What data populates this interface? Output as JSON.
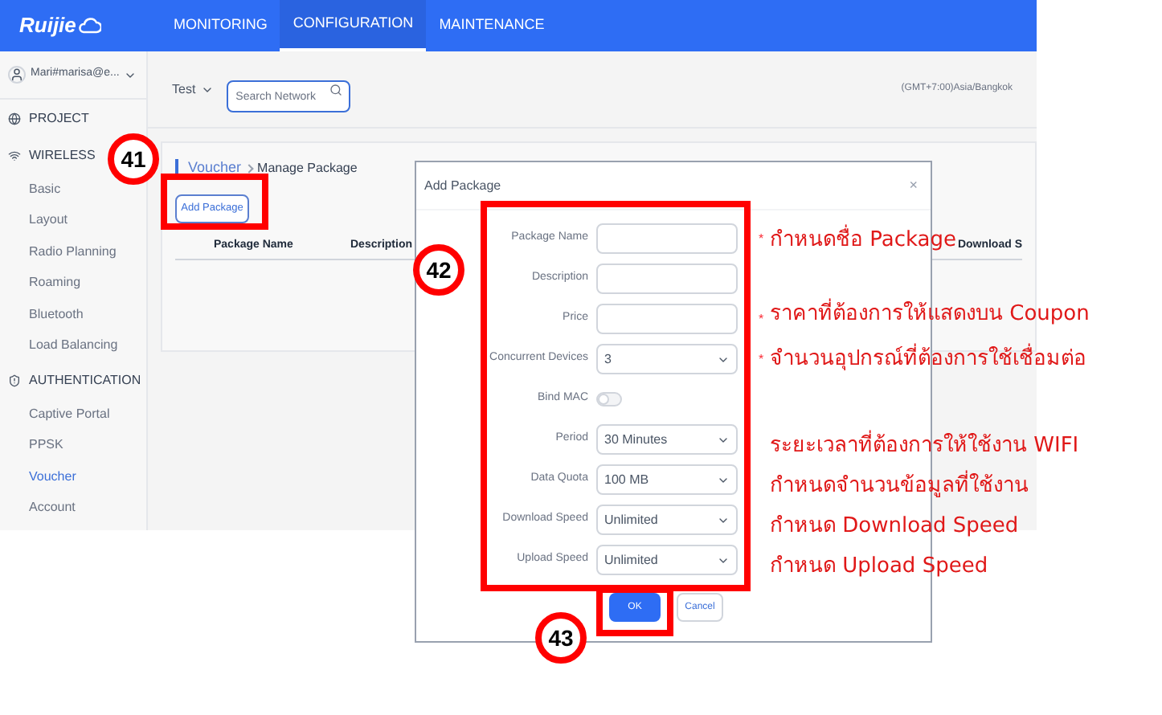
{
  "header": {
    "logo": "Ruijie",
    "nav": [
      {
        "label": "MONITORING",
        "selected": false
      },
      {
        "label": "CONFIGURATION",
        "selected": true
      },
      {
        "label": "MAINTENANCE",
        "selected": false
      }
    ]
  },
  "sidebar": {
    "account": "Mari#marisa@e...",
    "sections": [
      {
        "label": "PROJECT",
        "kind": "globe"
      },
      {
        "label": "WIRELESS",
        "kind": "wifi",
        "children": [
          {
            "label": "Basic",
            "selected": false
          },
          {
            "label": "Layout",
            "selected": false
          },
          {
            "label": "Radio Planning",
            "selected": false
          },
          {
            "label": "Roaming",
            "selected": false
          },
          {
            "label": "Bluetooth",
            "selected": false
          },
          {
            "label": "Load Balancing",
            "selected": false
          }
        ]
      },
      {
        "label": "AUTHENTICATION",
        "kind": "shield",
        "children": [
          {
            "label": "Captive Portal",
            "selected": false
          },
          {
            "label": "PPSK",
            "selected": false
          },
          {
            "label": "Voucher",
            "selected": true
          },
          {
            "label": "Account",
            "selected": false
          }
        ]
      }
    ]
  },
  "toolbar": {
    "network": "Test",
    "search": {
      "placeholder": "Search Network"
    },
    "timezone": "(GMT+7:00)Asia/Bangkok"
  },
  "breadcrumb": [
    "Voucher",
    "Manage Package"
  ],
  "add_button": "Add Package",
  "table": {
    "columns": [
      "Package Name",
      "Description",
      "Download S"
    ]
  },
  "dialog": {
    "title": "Add Package",
    "close": "×",
    "fields": [
      {
        "label": "Package Name",
        "kind": "input",
        "required_mark": "*"
      },
      {
        "label": "Description",
        "kind": "input"
      },
      {
        "label": "Price",
        "kind": "input",
        "required_mark": "*"
      },
      {
        "label": "Concurrent Devices",
        "kind": "select",
        "value": "3",
        "required_mark": "*"
      },
      {
        "label": "Bind MAC",
        "kind": "toggle",
        "on": false
      },
      {
        "label": "Period",
        "kind": "select",
        "value": "30 Minutes"
      },
      {
        "label": "Data Quota",
        "kind": "select",
        "value": "100 MB"
      },
      {
        "label": "Download Speed",
        "kind": "select",
        "value": "Unlimited"
      },
      {
        "label": "Upload Speed",
        "kind": "select",
        "value": "Unlimited"
      }
    ],
    "buttons": [
      {
        "label": "OK",
        "kind": "primary"
      },
      {
        "label": "Cancel",
        "kind": "secondary"
      }
    ]
  },
  "annotations": {
    "callouts": [
      "41",
      "42",
      "43"
    ],
    "notes": [
      "กำหนดชื่อ Package",
      "ราคาที่ต้องการให้แสดงบน Coupon",
      "จำนวนอุปกรณ์ที่ต้องการใช้เชื่อมต่อ",
      "ระยะเวลาที่ต้องการให้ใช้งาน WIFI",
      "กำหนดจำนวนข้อมูลที่ใช้งาน",
      "กำหนด Download Speed",
      "กำหนด Upload Speed"
    ]
  }
}
